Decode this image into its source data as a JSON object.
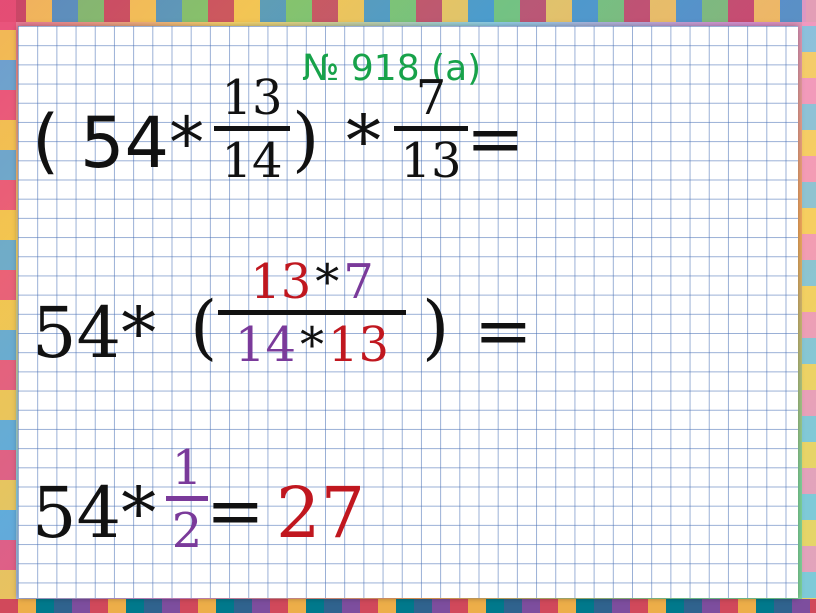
{
  "title": "№ 918 (а)",
  "line1": {
    "open_paren": "(",
    "factor": "54*",
    "frac1": {
      "num": "13",
      "den": "14"
    },
    "close_paren": ")",
    "times": "*",
    "frac2": {
      "num": "7",
      "den": "13"
    },
    "equals": "="
  },
  "line2": {
    "factor": "54*",
    "open_paren": "(",
    "num_a": "13",
    "num_op": "*",
    "num_b": "7",
    "den_a": "14",
    "den_op": "*",
    "den_b": "13",
    "close_paren": ")",
    "equals": "="
  },
  "line3": {
    "factor": "54*",
    "frac": {
      "num": "1",
      "den": "2"
    },
    "equals": "=",
    "result": "27"
  },
  "colors": {
    "title": "#17a24a",
    "red": "#c0171f",
    "purple": "#7a3a9a",
    "ink": "#111111"
  }
}
